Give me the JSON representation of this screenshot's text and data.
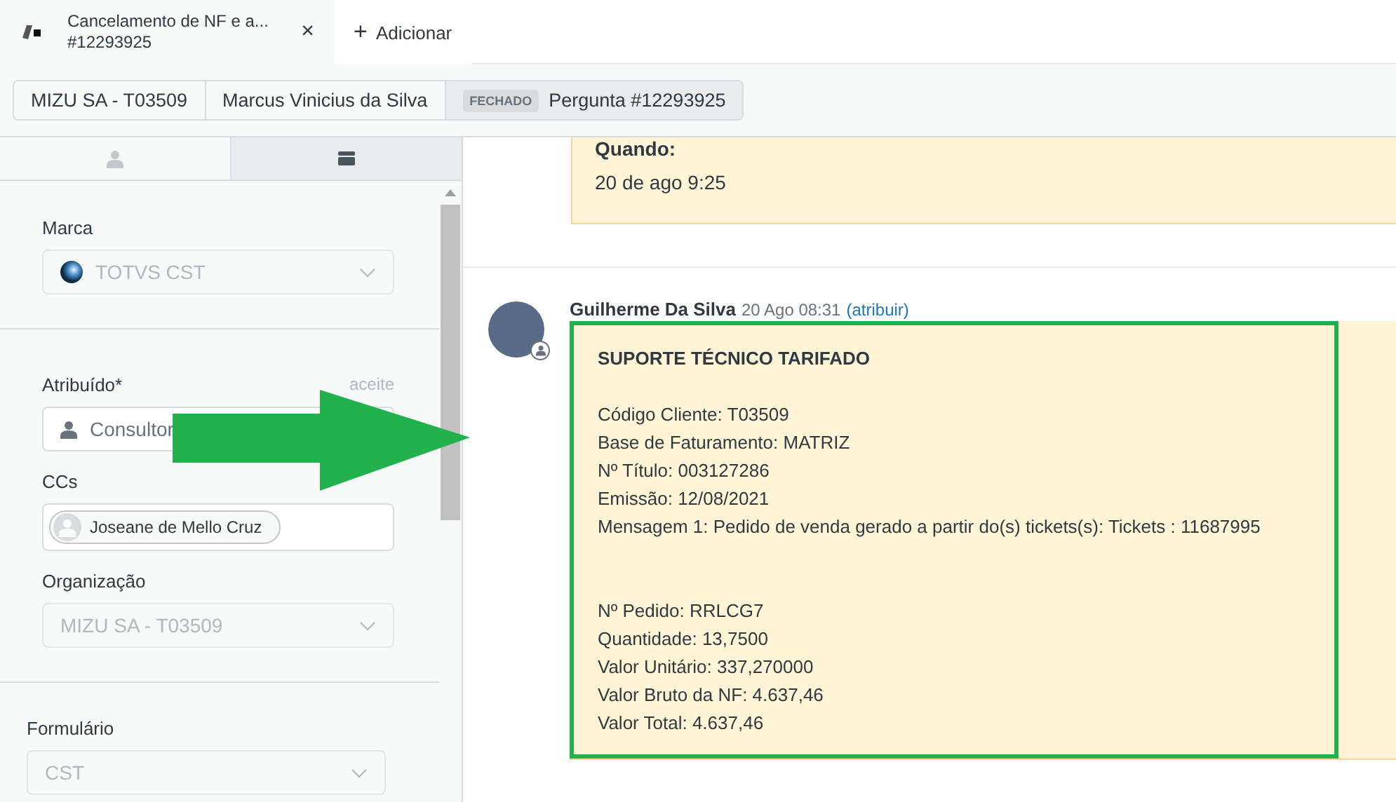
{
  "tabs": [
    {
      "title": "Cancelamento de NF e a...",
      "subtitle": "#12293925",
      "close": "×",
      "selected": true
    }
  ],
  "add_tab": {
    "label": "Adicionar",
    "icon": "+"
  },
  "breadcrumbs": [
    {
      "label": "MIZU SA - T03509",
      "selected": false
    },
    {
      "label": "Marcus Vinicius da Silva",
      "selected": false
    },
    {
      "label": "Pergunta #12293925",
      "badge": "FECHADO",
      "selected": true
    }
  ],
  "sidebar": {
    "tabs": [
      {
        "kind": "user",
        "selected": false
      },
      {
        "kind": "card",
        "selected": true
      }
    ],
    "sections": [
      {
        "fields": [
          {
            "kind": "select",
            "label": "Marca",
            "value": "TOTVS CST",
            "logo": true,
            "disabled": true
          }
        ]
      },
      {
        "fields": [
          {
            "kind": "select",
            "label": "Atribuído*",
            "link": "aceite",
            "value": "Consultor",
            "person": true,
            "disabled": false
          },
          {
            "kind": "tags",
            "label": "CCs",
            "tags": [
              "Joseane de Mello Cruz"
            ]
          },
          {
            "kind": "select",
            "label": "Organização",
            "value": "MIZU SA - T03509",
            "disabled": true
          }
        ]
      },
      {
        "fields": [
          {
            "kind": "select",
            "label": "Formulário",
            "value": "CST",
            "disabled": true
          }
        ]
      }
    ]
  },
  "conversation": {
    "previous": {
      "label": "Quando:",
      "value": "20 de ago 9:25"
    },
    "comment": {
      "author": "Guilherme Da Silva",
      "time": "20 Ago 08:31",
      "action": "(atribuir)",
      "heading": "SUPORTE TÉCNICO TARIFADO",
      "blocks": [
        [
          "Código Cliente: T03509",
          "Base de Faturamento: MATRIZ",
          "Nº Título: 003127286",
          "Emissão: 12/08/2021",
          "Mensagem 1: Pedido de venda gerado a partir do(s) tickets(s): Tickets : 11687995"
        ],
        [
          "Nº Pedido: RRLCG7",
          "Quantidade: 13,7500",
          "Valor Unitário: 337,270000",
          "Valor Bruto da NF: 4.637,46",
          "Valor Total: 4.637,46"
        ]
      ]
    }
  },
  "annotation": {
    "kind": "arrow"
  }
}
